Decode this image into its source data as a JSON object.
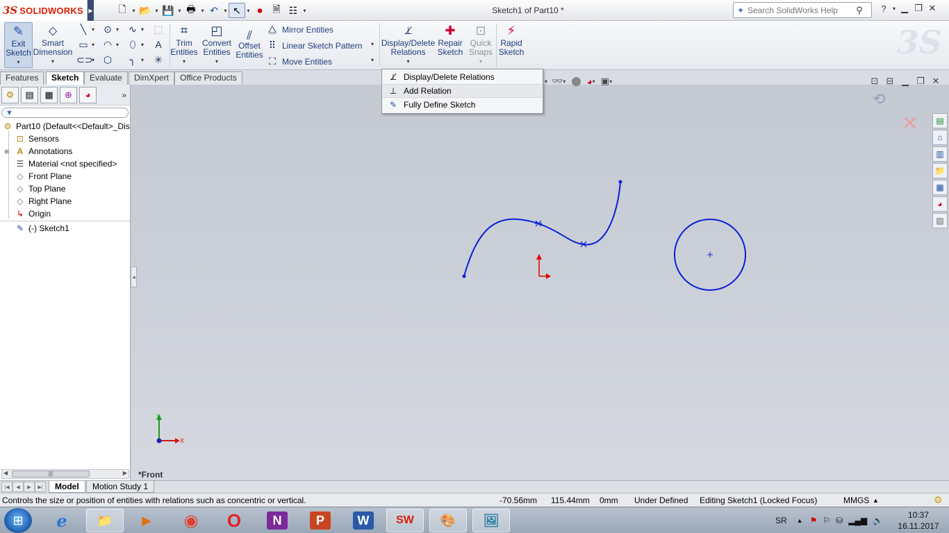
{
  "app": {
    "brand_ds": "3S",
    "brand_name": "SOLIDWORKS",
    "window_title": "Sketch1 of Part10 *"
  },
  "help_search": {
    "placeholder": "Search SolidWorks Help"
  },
  "ribbon": {
    "exit_sketch": "Exit\nSketch",
    "smart_dimension": "Smart\nDimension",
    "trim_entities": "Trim\nEntities",
    "convert_entities": "Convert\nEntities",
    "offset_entities": "Offset\nEntities",
    "mirror_entities": "Mirror Entities",
    "linear_sketch_pattern": "Linear Sketch Pattern",
    "move_entities": "Move Entities",
    "display_delete_relations": "Display/Delete\nRelations",
    "repair_sketch": "Repair\nSketch",
    "quick_snaps": "Quick\nSnaps",
    "rapid_sketch": "Rapid\nSketch"
  },
  "command_tabs": [
    "Features",
    "Sketch",
    "Evaluate",
    "DimXpert",
    "Office Products"
  ],
  "active_command_tab": "Sketch",
  "relations_menu": {
    "items": [
      "Display/Delete Relations",
      "Add Relation",
      "Fully Define Sketch"
    ],
    "highlighted": "Add Relation"
  },
  "feature_tree": {
    "root": "Part10  (Default<<Default>_Dis",
    "items": [
      {
        "label": "Sensors",
        "icon": "sensor-icon"
      },
      {
        "label": "Annotations",
        "icon": "annotation-icon"
      },
      {
        "label": "Material <not specified>",
        "icon": "material-icon"
      },
      {
        "label": "Front Plane",
        "icon": "plane-icon"
      },
      {
        "label": "Top Plane",
        "icon": "plane-icon"
      },
      {
        "label": "Right Plane",
        "icon": "plane-icon"
      },
      {
        "label": "Origin",
        "icon": "origin-icon"
      },
      {
        "label": "(-) Sketch1",
        "icon": "sketch-icon"
      }
    ]
  },
  "graphics": {
    "view_label": "*Front",
    "triad_x": "X",
    "triad_y": "Y",
    "sketch_color": "#0a1fd6"
  },
  "bottom_tabs": [
    "Model",
    "Motion Study 1"
  ],
  "active_bottom_tab": "Model",
  "status": {
    "message": "Controls the size or position of entities with relations such as concentric or vertical.",
    "x": "-70.56mm",
    "y": "115.44mm",
    "z": "0mm",
    "definition": "Under Defined",
    "editing": "Editing Sketch1 (Locked Focus)",
    "units": "MMGS"
  },
  "taskbar": {
    "apps": [
      "Internet Explorer",
      "File Explorer",
      "Media Player",
      "Chrome",
      "Opera",
      "OneNote",
      "PowerPoint",
      "Word",
      "SolidWorks",
      "Paint",
      "Photos"
    ],
    "language": "SR",
    "time": "10:37",
    "date": "16.11.2017"
  }
}
